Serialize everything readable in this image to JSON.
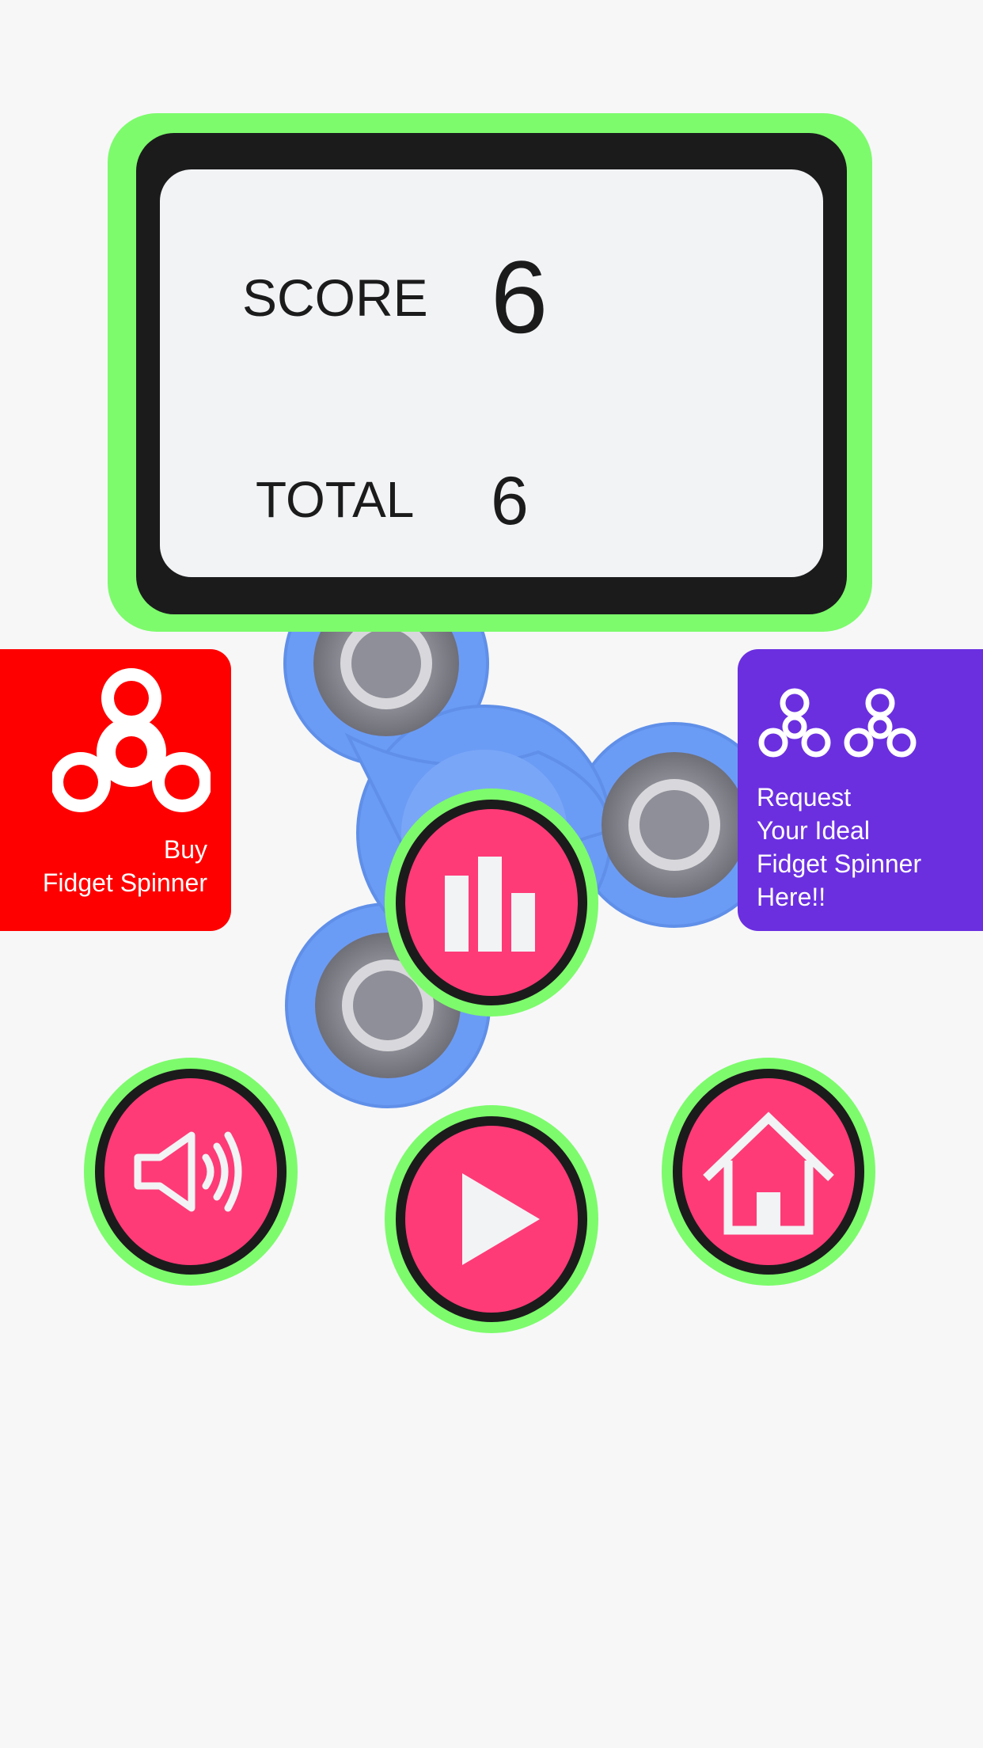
{
  "score_panel": {
    "score_label": "SCORE",
    "score_value": "6",
    "total_label": "TOTAL",
    "total_value": "6"
  },
  "cards": {
    "buy": {
      "line1": "Buy",
      "line2": "Fidget Spinner",
      "icon": "fidget-spinner-icon",
      "color": "#fe0000"
    },
    "request": {
      "line1": "Request",
      "line2": "Your Ideal",
      "line3": "Fidget Spinner",
      "line4": "Here!!",
      "icon": "fidget-spinner-pair-icon",
      "color": "#6b2fe0"
    }
  },
  "buttons": {
    "stats": {
      "icon": "bar-chart-icon"
    },
    "sound": {
      "icon": "speaker-icon"
    },
    "play": {
      "icon": "play-icon"
    },
    "home": {
      "icon": "home-icon"
    }
  },
  "colors": {
    "accent_green": "#7dfb6c",
    "button_pink": "#fe3b77",
    "frame_dark": "#1b1b1c",
    "spinner_blue": "#6b9cf5"
  }
}
